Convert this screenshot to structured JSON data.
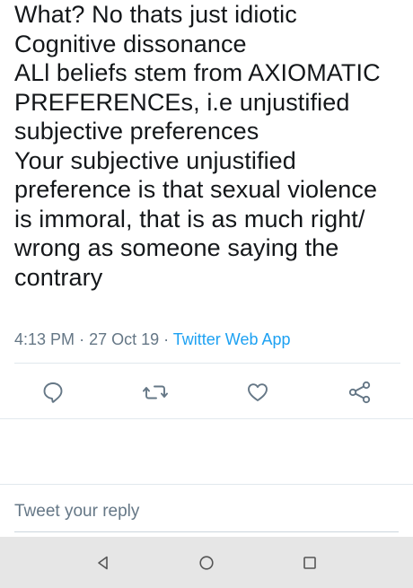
{
  "tweet": {
    "lines": [
      "What? No thats just idiotic",
      "Cognitive dissonance",
      "ALl beliefs stem from AXIOMATIC",
      "PREFERENCEs, i.e unjustified",
      "subjective preferences",
      "Your subjective  unjustified",
      "preference is that sexual violence",
      "is immoral, that is as much right/",
      "wrong as someone saying the",
      "contrary"
    ],
    "time": "4:13 PM",
    "separator": "·",
    "date": "27 Oct 19",
    "source": "Twitter Web App"
  },
  "actions": [
    {
      "name": "reply",
      "icon": "comment-icon"
    },
    {
      "name": "retweet",
      "icon": "retweet-icon"
    },
    {
      "name": "like",
      "icon": "heart-icon"
    },
    {
      "name": "share",
      "icon": "share-icon"
    }
  ],
  "reply": {
    "placeholder": "Tweet your reply"
  },
  "navigation": {
    "buttons": [
      "back-icon",
      "home-icon",
      "recents-icon"
    ]
  },
  "colors": {
    "text": "#14171a",
    "secondary": "#657786",
    "link": "#1da1f2",
    "divider": "#e1e8ed",
    "navbar": "#e6e6e6"
  }
}
